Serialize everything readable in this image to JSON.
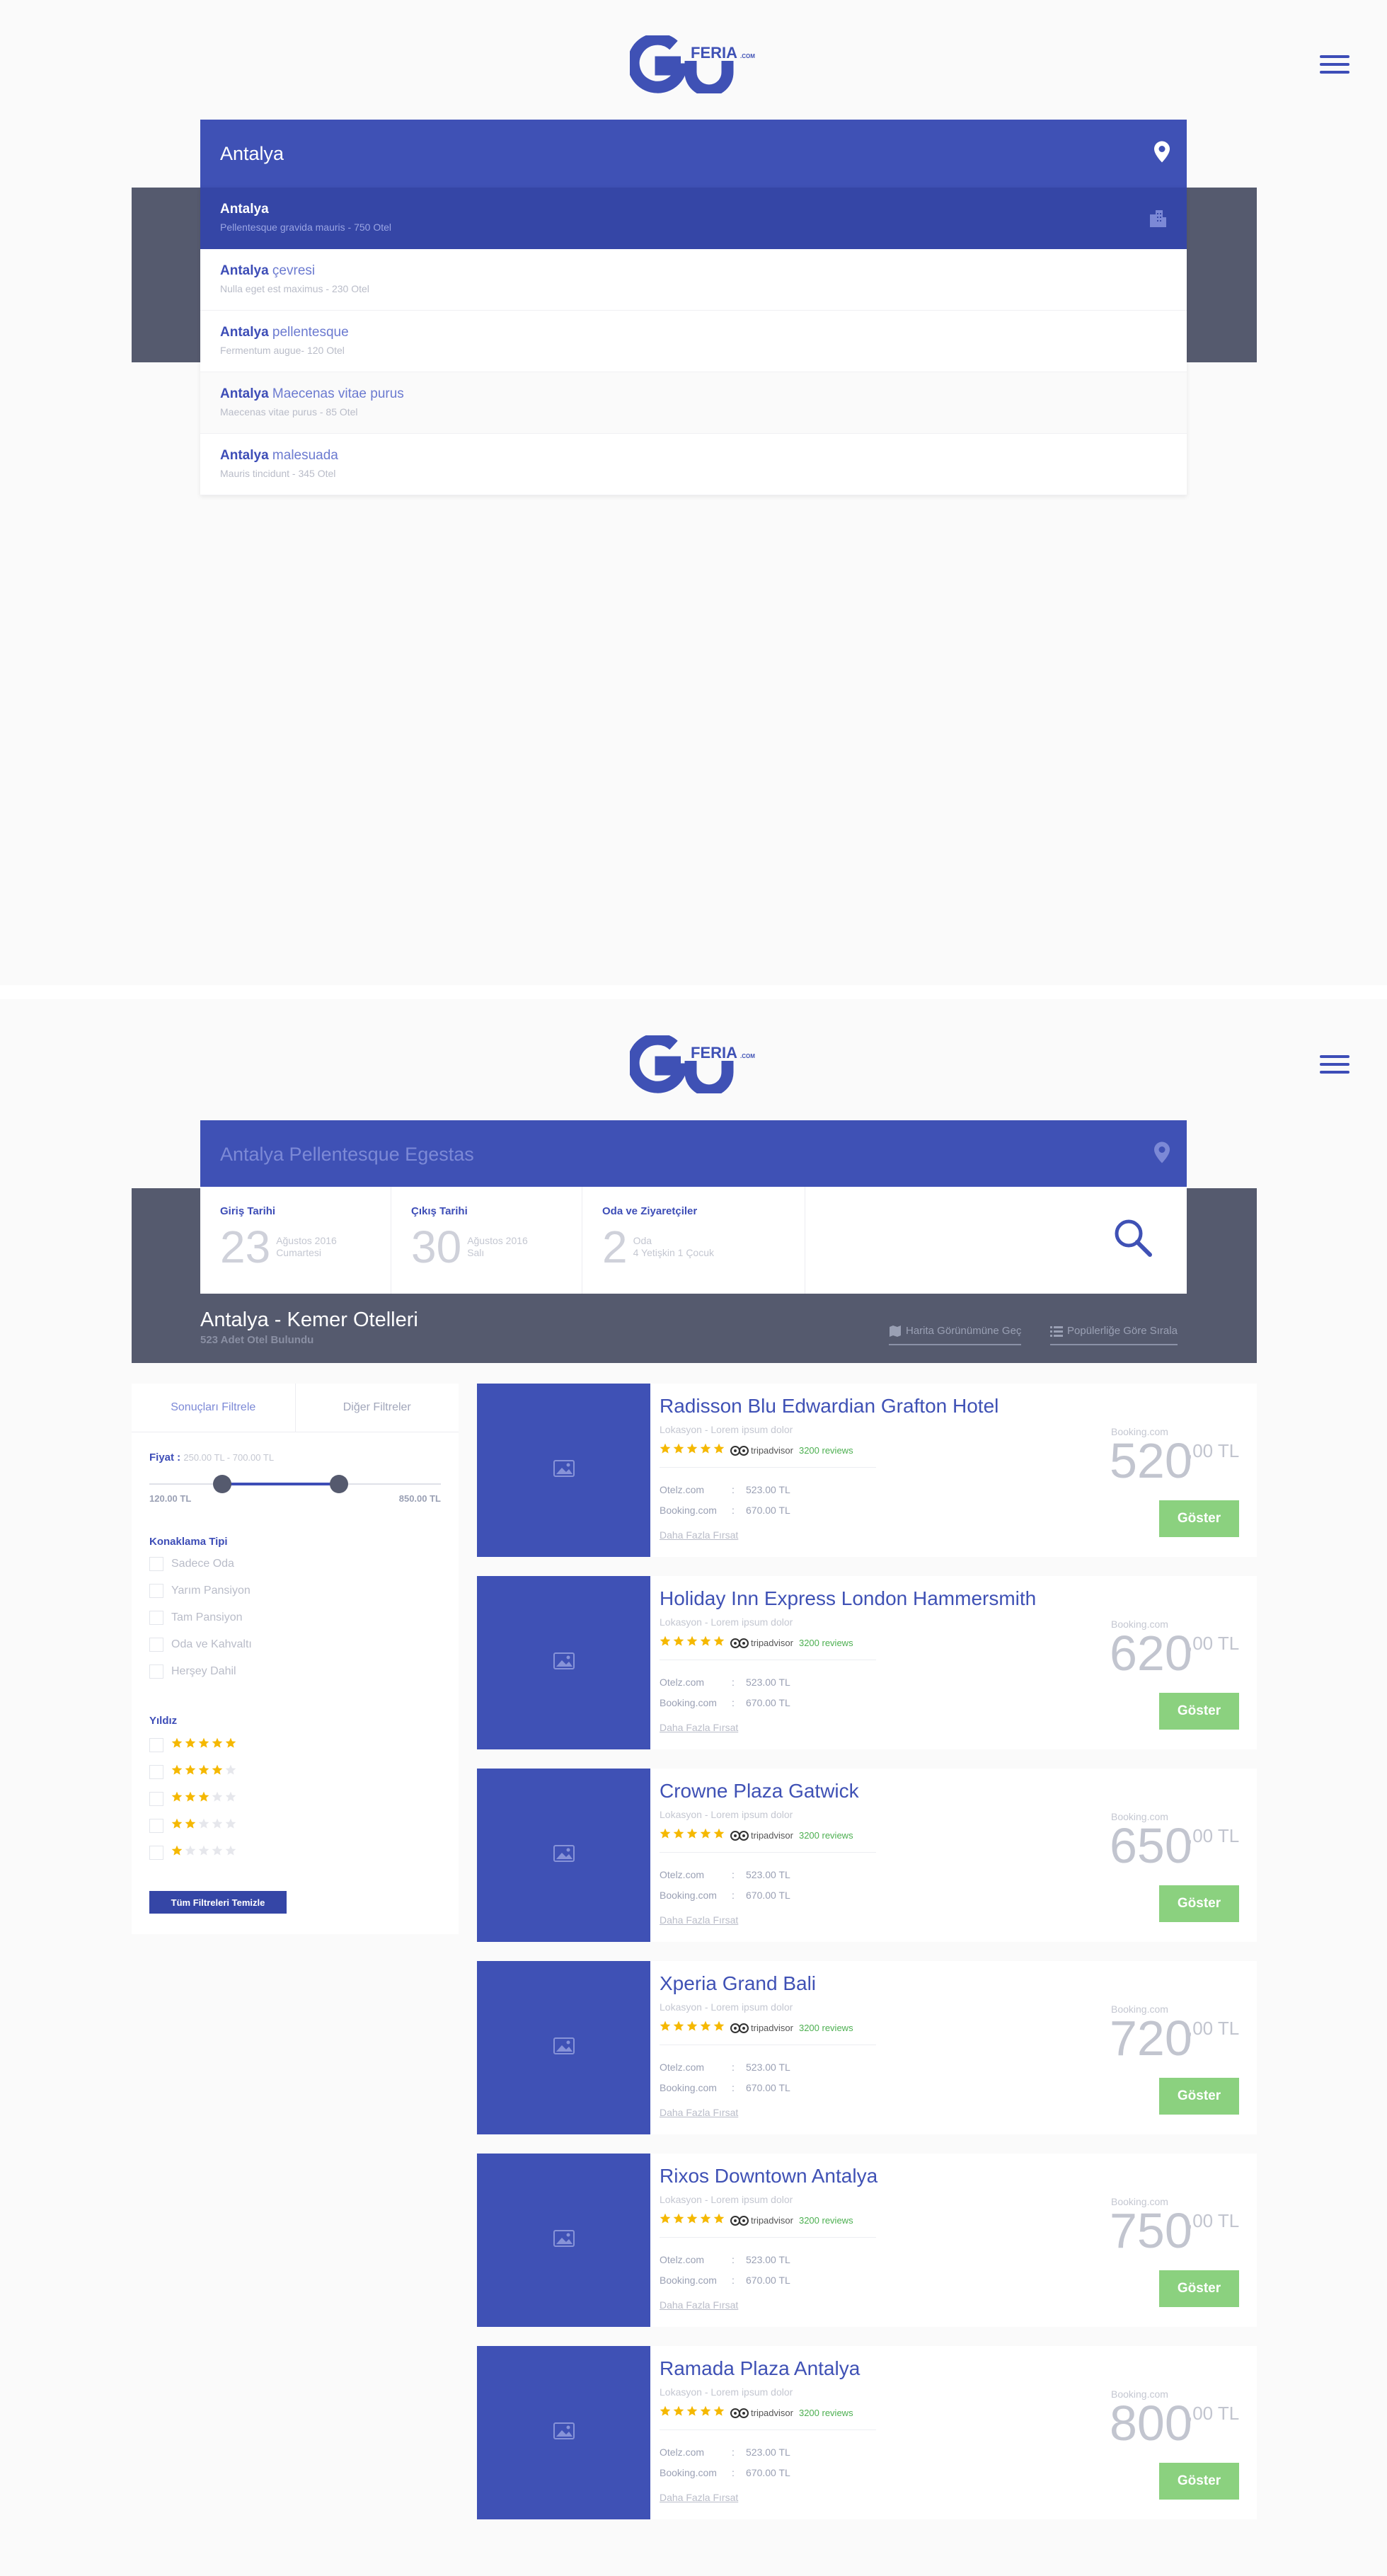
{
  "brand": {
    "logo_main": "GO",
    "logo_sub": "FERIA",
    "logo_tld": ".COM",
    "accent": "#3f51b5",
    "dark": "#555a6e",
    "green": "#8bd17f"
  },
  "screen1": {
    "search_value": "Antalya",
    "suggestions": [
      {
        "city": "Antalya",
        "rest": "",
        "sub": "Pellentesque gravida mauris - 750 Otel"
      },
      {
        "city": "Antalya",
        "rest": " çevresi",
        "sub": "Nulla eget est maximus - 230 Otel"
      },
      {
        "city": "Antalya",
        "rest": " pellentesque",
        "sub": "Fermentum augue- 120 Otel"
      },
      {
        "city": "Antalya",
        "rest": " Maecenas vitae purus",
        "sub": "Maecenas vitae purus - 85 Otel"
      },
      {
        "city": "Antalya",
        "rest": " malesuada",
        "sub": "Mauris tincidunt - 345 Otel"
      }
    ]
  },
  "screen2": {
    "search_value": "Antalya Pellentesque Egestas",
    "checkin": {
      "label": "Giriş Tarihi",
      "day": "23",
      "month": "Ağustos 2016",
      "weekday": "Cumartesi"
    },
    "checkout": {
      "label": "Çıkış Tarihi",
      "day": "30",
      "month": "Ağustos 2016",
      "weekday": "Salı"
    },
    "rooms": {
      "label": "Oda ve Ziyaretçiler",
      "count": "2",
      "unit": "Oda",
      "guests": "4 Yetişkin 1 Çocuk"
    },
    "results_title": "Antalya - Kemer Otelleri",
    "results_count": "523 Adet Otel Bulundu",
    "map_link": "Harita Görünümüne Geç",
    "sort_link": "Popülerliğe Göre Sırala",
    "filter": {
      "tab_results": "Sonuçları Filtrele",
      "tab_other": "Diğer Filtreler",
      "price_label": "Fiyat :",
      "price_range": "250.00 TL - 700.00 TL",
      "slider_min": "120.00 TL",
      "slider_max": "850.00 TL",
      "slider_low_fraction": 0.25,
      "slider_high_fraction": 0.65,
      "lodging_title": "Konaklama Tipi",
      "lodging": [
        "Sadece Oda",
        "Yarım Pansiyon",
        "Tam Pansiyon",
        "Oda ve Kahvaltı",
        "Herşey Dahil"
      ],
      "stars_title": "Yıldız",
      "star_levels": [
        5,
        4,
        3,
        2,
        1
      ],
      "clear": "Tüm Filtreleri Temizle"
    },
    "hotels": [
      {
        "name": "Radisson Blu Edwardian Grafton Hotel",
        "price": "520",
        "cents": ",00 TL"
      },
      {
        "name": "Holiday Inn Express London Hammersmith",
        "price": "620",
        "cents": ",00 TL"
      },
      {
        "name": "Crowne Plaza Gatwick",
        "price": "650",
        "cents": ",00 TL"
      },
      {
        "name": "Xperia Grand Bali",
        "price": "720",
        "cents": ",00 TL"
      },
      {
        "name": "Rixos Downtown Antalya",
        "price": "750",
        "cents": ",00 TL"
      },
      {
        "name": "Ramada Plaza Antalya",
        "price": "800",
        "cents": ",00 TL"
      }
    ],
    "card_common": {
      "location": "Lokasyon - Lorem ipsum dolor",
      "stars": 5,
      "tripadvisor": "tripadvisor",
      "reviews": "3200 reviews",
      "provider1": "Otelz.com",
      "provider1_price": "523.00 TL",
      "provider2": "Booking.com",
      "provider2_price": "670.00 TL",
      "more": "Daha Fazla Fırsat",
      "source": "Booking.com",
      "button": "Göster"
    }
  }
}
